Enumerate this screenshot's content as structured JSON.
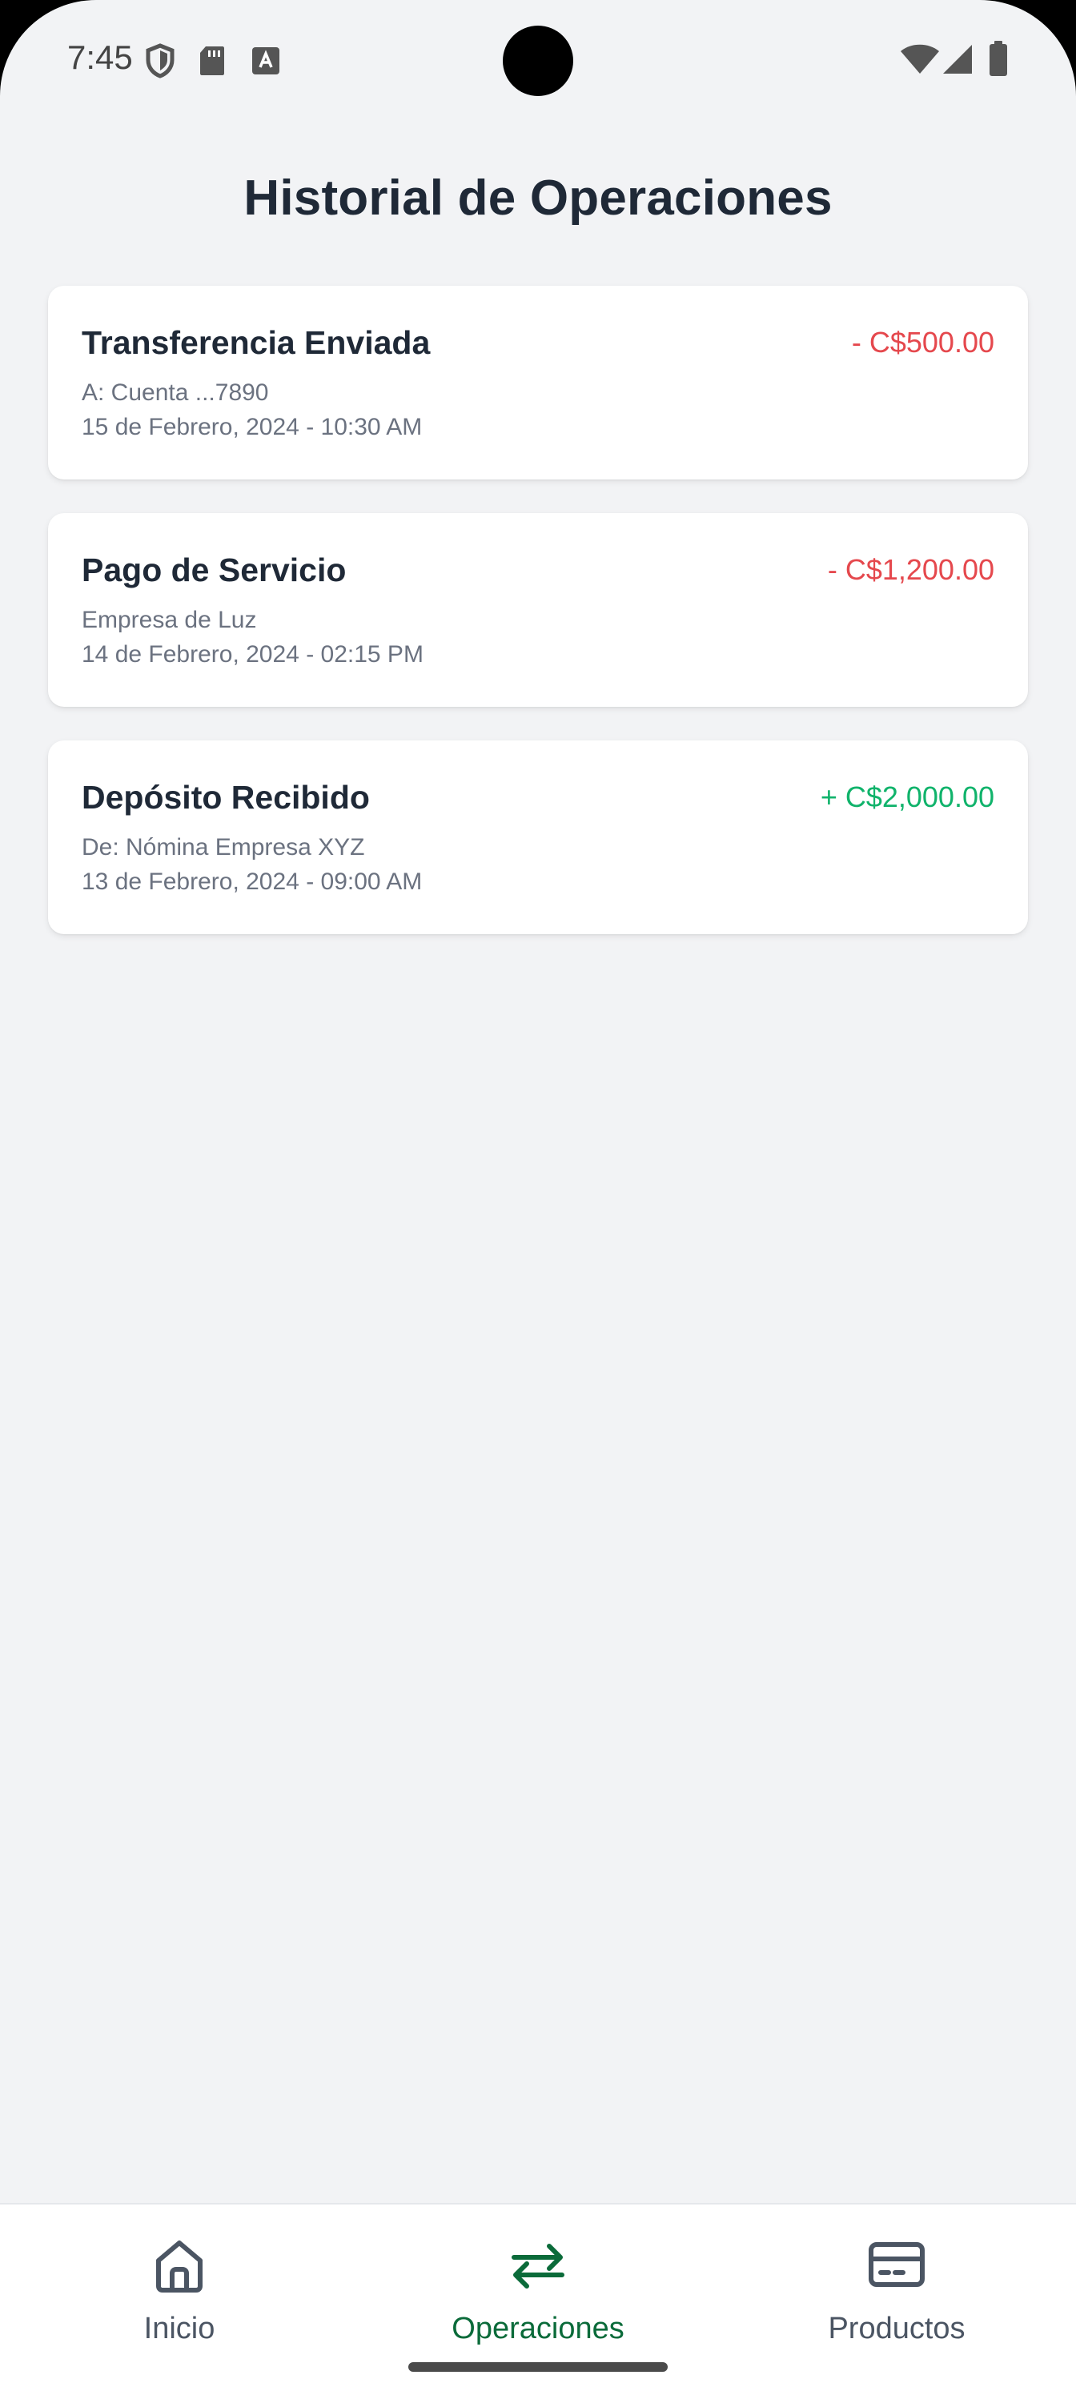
{
  "status_bar": {
    "time": "7:45",
    "icons": [
      "shield-icon",
      "sd-card-icon",
      "font-icon",
      "wifi-icon",
      "signal-icon",
      "battery-icon"
    ]
  },
  "page": {
    "title": "Historial de Operaciones"
  },
  "transactions": [
    {
      "title": "Transferencia Enviada",
      "amount": "- C$500.00",
      "type": "debit",
      "detail": "A: Cuenta ...7890",
      "date": "15 de Febrero, 2024 - 10:30 AM"
    },
    {
      "title": "Pago de Servicio",
      "amount": "- C$1,200.00",
      "type": "debit",
      "detail": "Empresa de Luz",
      "date": "14 de Febrero, 2024 - 02:15 PM"
    },
    {
      "title": "Depósito Recibido",
      "amount": "+ C$2,000.00",
      "type": "credit",
      "detail": "De: Nómina Empresa XYZ",
      "date": "13 de Febrero, 2024 - 09:00 AM"
    }
  ],
  "bottom_nav": {
    "items": [
      {
        "label": "Inicio",
        "icon": "home-icon",
        "active": false
      },
      {
        "label": "Operaciones",
        "icon": "transfer-arrows-icon",
        "active": true
      },
      {
        "label": "Productos",
        "icon": "card-icon",
        "active": false
      }
    ]
  },
  "colors": {
    "background": "#f2f3f5",
    "debit": "#e5484d",
    "credit": "#10b36b",
    "active_nav": "#0b6b3a",
    "inactive_nav": "#4b5563"
  }
}
